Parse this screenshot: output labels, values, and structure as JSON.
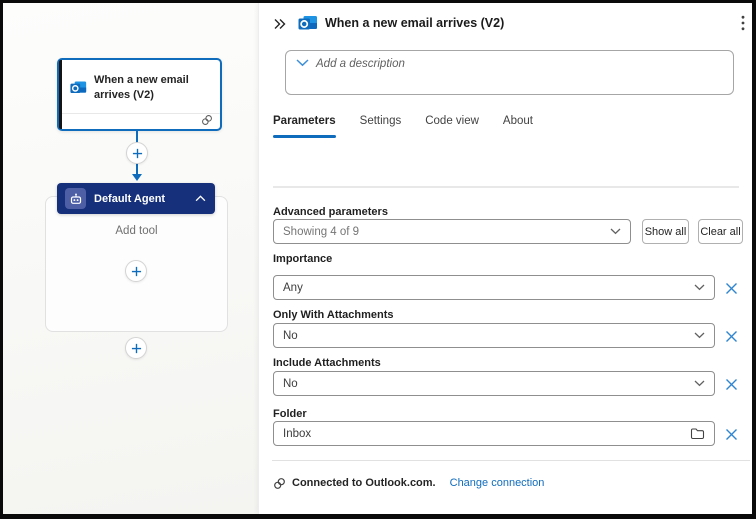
{
  "colors": {
    "accent": "#0F6CBD",
    "agent_header_bg": "#16307C",
    "agent_badge_bg": "#4E5FA6",
    "selected_card_border": "#0F6CBD",
    "link": "#0F6CBD"
  },
  "canvas": {
    "trigger_card": {
      "title": "When a new email arrives (V2)",
      "icon": "outlook-icon",
      "status_icon": "connection-icon"
    },
    "insert_button_label": "+",
    "agent": {
      "title": "Default Agent",
      "icon": "agent-icon",
      "collapse_icon": "chevron-up-icon",
      "add_tool_label": "Add tool"
    }
  },
  "panel": {
    "collapse_icon": "double-chevron-right-icon",
    "icon": "outlook-icon",
    "title": "When a new email arrives (V2)",
    "menu_icon": "more-vertical-icon",
    "description": {
      "placeholder": "Add a description",
      "value": ""
    },
    "tabs": [
      {
        "label": "Parameters",
        "active": true
      },
      {
        "label": "Settings",
        "active": false
      },
      {
        "label": "Code view",
        "active": false
      },
      {
        "label": "About",
        "active": false
      }
    ],
    "advanced_parameters": {
      "label": "Advanced parameters",
      "dropdown_value": "Showing 4 of 9",
      "show_all_button": "Show all",
      "clear_all_button": "Clear all"
    },
    "fields": [
      {
        "label": "Importance",
        "value": "Any",
        "control": "dropdown"
      },
      {
        "label": "Only With Attachments",
        "value": "No",
        "control": "dropdown"
      },
      {
        "label": "Include Attachments",
        "value": "No",
        "control": "dropdown"
      },
      {
        "label": "Folder",
        "value": "Inbox",
        "control": "folder-picker"
      }
    ],
    "footer": {
      "status_icon": "connection-icon",
      "status_text": "Connected to Outlook.com.",
      "action_label": "Change connection"
    }
  }
}
